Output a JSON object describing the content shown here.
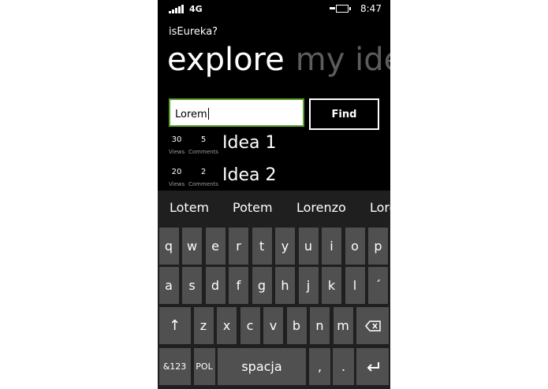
{
  "status": {
    "network": "4G",
    "time": "8:47"
  },
  "app": {
    "title": "isEureka?"
  },
  "pivot": {
    "active": "explore",
    "next": "my ideas"
  },
  "search": {
    "value": "Lorem",
    "button": "Find"
  },
  "ideas": [
    {
      "views": "30",
      "views_label": "Views",
      "comments": "5",
      "comments_label": "Comments",
      "title": "Idea 1"
    },
    {
      "views": "20",
      "views_label": "Views",
      "comments": "2",
      "comments_label": "Comments",
      "title": "Idea 2"
    }
  ],
  "keyboard": {
    "suggestions": [
      "Lotem",
      "Potem",
      "Lorenzo",
      "Lorem"
    ],
    "row1": [
      "q",
      "w",
      "e",
      "r",
      "t",
      "y",
      "u",
      "i",
      "o",
      "p"
    ],
    "row2": [
      "a",
      "s",
      "d",
      "f",
      "g",
      "h",
      "j",
      "k",
      "l",
      "´"
    ],
    "row3": [
      "z",
      "x",
      "c",
      "v",
      "b",
      "n",
      "m"
    ],
    "symbols": "&123",
    "language": "POL",
    "space": "spacja",
    "comma": ",",
    "period": ".",
    "shift_icon": "shift-arrow-icon",
    "backspace_icon": "backspace-icon",
    "enter_icon": "enter-icon"
  },
  "colors": {
    "accent": "#5aa02c",
    "key": "#505050",
    "keyboard_bg": "#1f1f1f"
  }
}
